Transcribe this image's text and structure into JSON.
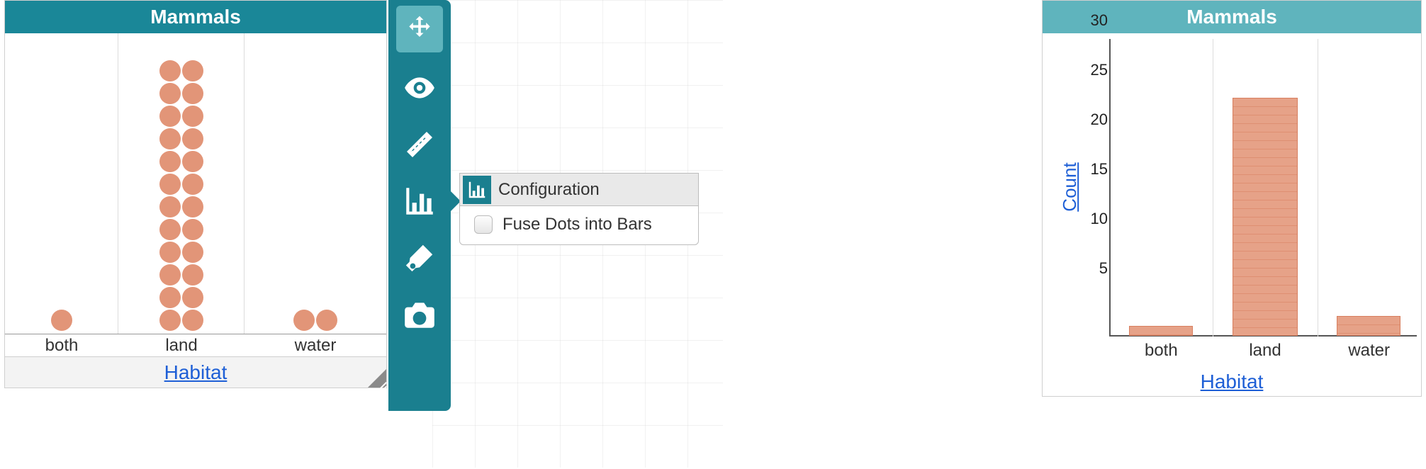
{
  "left_chart": {
    "title": "Mammals",
    "x_axis_label": "Habitat",
    "categories": [
      "both",
      "land",
      "water"
    ]
  },
  "toolbar": {
    "items": [
      {
        "name": "move",
        "active": false
      },
      {
        "name": "visibility",
        "active": false
      },
      {
        "name": "ruler",
        "active": false
      },
      {
        "name": "chart-config",
        "active": true
      },
      {
        "name": "paint",
        "active": false
      },
      {
        "name": "camera",
        "active": false
      }
    ]
  },
  "popover": {
    "header_label": "Configuration",
    "option_label": "Fuse Dots into Bars",
    "option_checked": false
  },
  "right_chart": {
    "title": "Mammals",
    "y_axis_label": "Count",
    "x_axis_label": "Habitat",
    "y_ticks": [
      "5",
      "10",
      "15",
      "20",
      "25",
      "30"
    ],
    "categories": [
      "both",
      "land",
      "water"
    ]
  },
  "chart_data": [
    {
      "type": "dot",
      "title": "Mammals",
      "xlabel": "Habitat",
      "categories": [
        "both",
        "land",
        "water"
      ],
      "values": [
        1,
        24,
        2
      ]
    },
    {
      "type": "bar",
      "title": "Mammals",
      "xlabel": "Habitat",
      "ylabel": "Count",
      "ylim": [
        0,
        30
      ],
      "categories": [
        "both",
        "land",
        "water"
      ],
      "values": [
        1,
        24,
        2
      ]
    }
  ]
}
